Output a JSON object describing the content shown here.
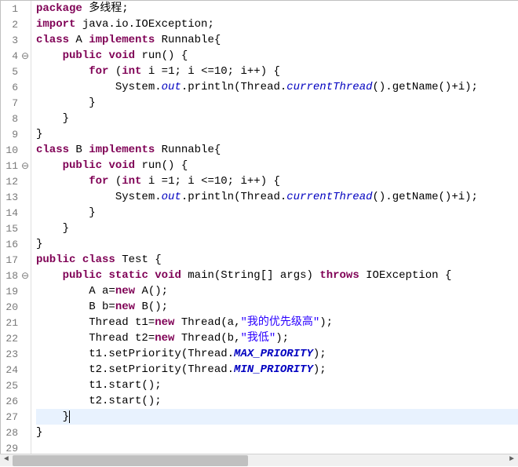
{
  "lines": [
    {
      "num": "1",
      "fold": "",
      "tokens": [
        [
          "kw",
          "package"
        ],
        [
          "norm",
          " 多线程;"
        ]
      ]
    },
    {
      "num": "2",
      "fold": "",
      "tokens": [
        [
          "kw",
          "import"
        ],
        [
          "norm",
          " java.io.IOException;"
        ]
      ]
    },
    {
      "num": "3",
      "fold": "",
      "tokens": [
        [
          "kw",
          "class"
        ],
        [
          "norm",
          " A "
        ],
        [
          "kw",
          "implements"
        ],
        [
          "norm",
          " Runnable{"
        ]
      ]
    },
    {
      "num": "4",
      "fold": "⊖",
      "tokens": [
        [
          "norm",
          "    "
        ],
        [
          "kw",
          "public"
        ],
        [
          "norm",
          " "
        ],
        [
          "kw",
          "void"
        ],
        [
          "norm",
          " run() {"
        ]
      ]
    },
    {
      "num": "5",
      "fold": "",
      "tokens": [
        [
          "norm",
          "        "
        ],
        [
          "kw",
          "for"
        ],
        [
          "norm",
          " ("
        ],
        [
          "kw",
          "int"
        ],
        [
          "norm",
          " i =1; i <=10; i++) {"
        ]
      ]
    },
    {
      "num": "6",
      "fold": "",
      "tokens": [
        [
          "norm",
          "            System."
        ],
        [
          "field",
          "out"
        ],
        [
          "norm",
          ".println(Thread."
        ],
        [
          "field",
          "currentThread"
        ],
        [
          "norm",
          "().getName()+i);"
        ]
      ]
    },
    {
      "num": "7",
      "fold": "",
      "tokens": [
        [
          "norm",
          "        }"
        ]
      ]
    },
    {
      "num": "8",
      "fold": "",
      "tokens": [
        [
          "norm",
          "    }"
        ]
      ]
    },
    {
      "num": "9",
      "fold": "",
      "tokens": [
        [
          "norm",
          "}"
        ]
      ]
    },
    {
      "num": "10",
      "fold": "",
      "tokens": [
        [
          "kw",
          "class"
        ],
        [
          "norm",
          " B "
        ],
        [
          "kw",
          "implements"
        ],
        [
          "norm",
          " Runnable{"
        ]
      ]
    },
    {
      "num": "11",
      "fold": "⊖",
      "tokens": [
        [
          "norm",
          "    "
        ],
        [
          "kw",
          "public"
        ],
        [
          "norm",
          " "
        ],
        [
          "kw",
          "void"
        ],
        [
          "norm",
          " run() {"
        ]
      ]
    },
    {
      "num": "12",
      "fold": "",
      "tokens": [
        [
          "norm",
          "        "
        ],
        [
          "kw",
          "for"
        ],
        [
          "norm",
          " ("
        ],
        [
          "kw",
          "int"
        ],
        [
          "norm",
          " i =1; i <=10; i++) {"
        ]
      ]
    },
    {
      "num": "13",
      "fold": "",
      "tokens": [
        [
          "norm",
          "            System."
        ],
        [
          "field",
          "out"
        ],
        [
          "norm",
          ".println(Thread."
        ],
        [
          "field",
          "currentThread"
        ],
        [
          "norm",
          "().getName()+i);"
        ]
      ]
    },
    {
      "num": "14",
      "fold": "",
      "tokens": [
        [
          "norm",
          "        }"
        ]
      ]
    },
    {
      "num": "15",
      "fold": "",
      "tokens": [
        [
          "norm",
          "    }"
        ]
      ]
    },
    {
      "num": "16",
      "fold": "",
      "tokens": [
        [
          "norm",
          "}"
        ]
      ]
    },
    {
      "num": "17",
      "fold": "",
      "tokens": [
        [
          "kw",
          "public"
        ],
        [
          "norm",
          " "
        ],
        [
          "kw",
          "class"
        ],
        [
          "norm",
          " Test {"
        ]
      ]
    },
    {
      "num": "18",
      "fold": "⊖",
      "tokens": [
        [
          "norm",
          "    "
        ],
        [
          "kw",
          "public"
        ],
        [
          "norm",
          " "
        ],
        [
          "kw",
          "static"
        ],
        [
          "norm",
          " "
        ],
        [
          "kw",
          "void"
        ],
        [
          "norm",
          " main(String[] args) "
        ],
        [
          "kw",
          "throws"
        ],
        [
          "norm",
          " IOException {"
        ]
      ]
    },
    {
      "num": "19",
      "fold": "",
      "tokens": [
        [
          "norm",
          "        A a="
        ],
        [
          "kw",
          "new"
        ],
        [
          "norm",
          " A();"
        ]
      ]
    },
    {
      "num": "20",
      "fold": "",
      "tokens": [
        [
          "norm",
          "        B b="
        ],
        [
          "kw",
          "new"
        ],
        [
          "norm",
          " B();"
        ]
      ]
    },
    {
      "num": "21",
      "fold": "",
      "tokens": [
        [
          "norm",
          "        Thread t1="
        ],
        [
          "kw",
          "new"
        ],
        [
          "norm",
          " Thread(a,"
        ],
        [
          "str",
          "\"我的优先级高\""
        ],
        [
          "norm",
          ");"
        ]
      ]
    },
    {
      "num": "22",
      "fold": "",
      "tokens": [
        [
          "norm",
          "        Thread t2="
        ],
        [
          "kw",
          "new"
        ],
        [
          "norm",
          " Thread(b,"
        ],
        [
          "str",
          "\"我低\""
        ],
        [
          "norm",
          ");"
        ]
      ]
    },
    {
      "num": "23",
      "fold": "",
      "tokens": [
        [
          "norm",
          "        t1.setPriority(Thread."
        ],
        [
          "const",
          "MAX_PRIORITY"
        ],
        [
          "norm",
          ");"
        ]
      ]
    },
    {
      "num": "24",
      "fold": "",
      "tokens": [
        [
          "norm",
          "        t2.setPriority(Thread."
        ],
        [
          "const",
          "MIN_PRIORITY"
        ],
        [
          "norm",
          ");"
        ]
      ]
    },
    {
      "num": "25",
      "fold": "",
      "tokens": [
        [
          "norm",
          "        t1.start();"
        ]
      ]
    },
    {
      "num": "26",
      "fold": "",
      "tokens": [
        [
          "norm",
          "        t2.start();"
        ]
      ]
    },
    {
      "num": "27",
      "fold": "",
      "hl": true,
      "cursor": true,
      "tokens": [
        [
          "norm",
          "    }"
        ]
      ]
    },
    {
      "num": "28",
      "fold": "",
      "tokens": [
        [
          "norm",
          "}"
        ]
      ]
    },
    {
      "num": "29",
      "fold": "",
      "tokens": [
        [
          "norm",
          ""
        ]
      ]
    }
  ],
  "scrollbar": {
    "arrow_left": "◄",
    "arrow_right": "►"
  }
}
